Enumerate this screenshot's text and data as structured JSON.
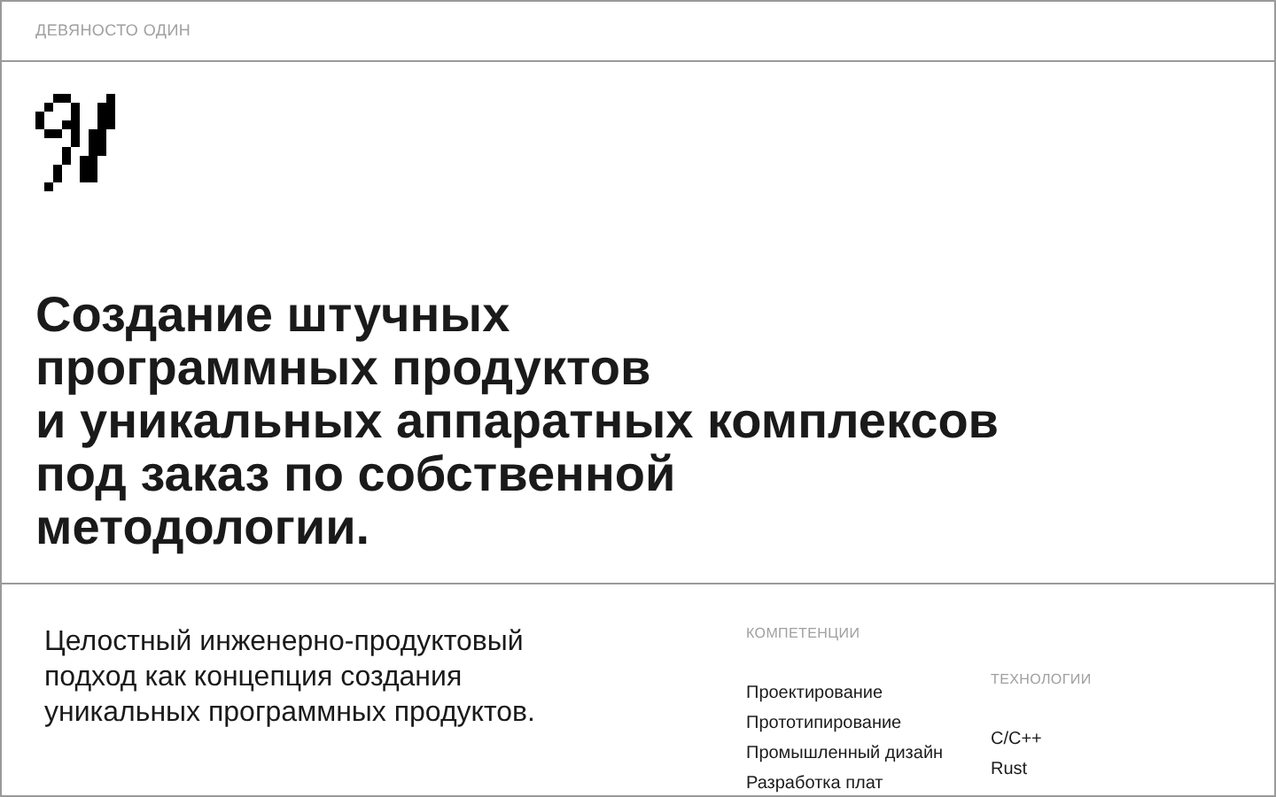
{
  "header": {
    "brand": "ДЕВЯНОСТО ОДИН"
  },
  "headline": [
    "Создание штучных",
    "программных продуктов",
    "и уникальных аппаратных комплексов",
    "под заказ по собственной",
    "методологии."
  ],
  "intro": "Целостный инженерно-продуктовый подход как концепция создания уникальных программных продуктов.",
  "competencies": {
    "title": "КОМПЕТЕНЦИИ",
    "items": [
      "Проектирование",
      "Прототипирование",
      "Промышленный дизайн",
      "Разработка плат"
    ]
  },
  "technologies": {
    "title": "ТЕХНОЛОГИИ",
    "items": [
      "C/C++",
      "Rust"
    ]
  }
}
